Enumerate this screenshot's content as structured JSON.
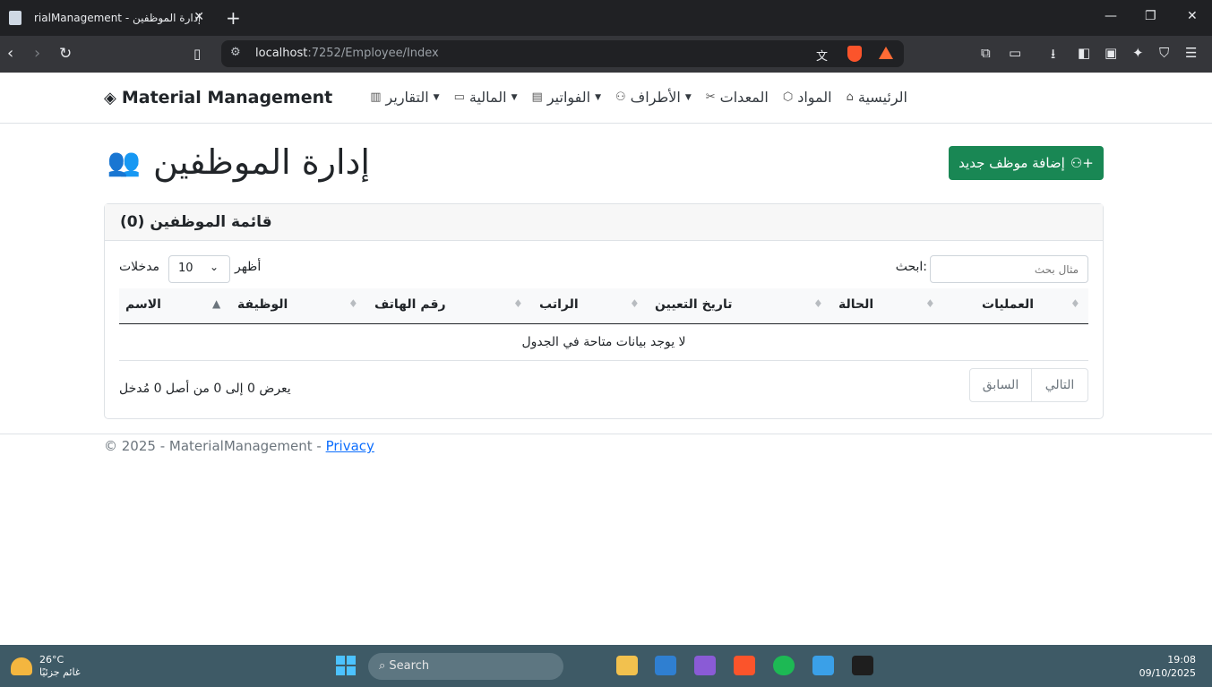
{
  "browser": {
    "tab_title": "rialManagement - إدارة الموظفين",
    "url_host": "localhost",
    "url_path": ":7252/Employee/Index",
    "colors": {
      "chrome_dark": "#202124",
      "toolbar": "#35363a"
    }
  },
  "navbar": {
    "brand": "Material Management",
    "links": [
      {
        "label": "الرئيسية",
        "icon": "home-icon"
      },
      {
        "label": "المواد",
        "icon": "box-icon"
      },
      {
        "label": "المعدات",
        "icon": "tools-icon"
      },
      {
        "label": "الأطراف",
        "icon": "people-icon",
        "dropdown": true
      },
      {
        "label": "الفواتير",
        "icon": "receipt-icon",
        "dropdown": true
      },
      {
        "label": "المالية",
        "icon": "folder-icon",
        "dropdown": true
      },
      {
        "label": "التقارير",
        "icon": "chart-icon",
        "dropdown": true
      }
    ]
  },
  "page": {
    "heading": "إدارة الموظفين",
    "add_button": "إضافة موظف جديد",
    "card_title": "قائمة الموظفين (0)",
    "search_label": ":ابحث",
    "search_placeholder": "مثال بحث",
    "length_show": "أظهر",
    "length_value": "10",
    "length_entries": "مدخلات",
    "columns": [
      "الاسم",
      "الوظيفة",
      "رقم الهاتف",
      "الراتب",
      "تاريخ التعيين",
      "الحالة",
      "العمليات"
    ],
    "empty_message": "لا يوجد بيانات متاحة في الجدول",
    "info": "يعرض 0 إلى 0 من أصل 0 مُدخل",
    "pager_prev": "السابق",
    "pager_next": "التالي",
    "colors": {
      "success": "#198754",
      "link": "#0d6efd"
    }
  },
  "footer": {
    "text": "© 2025 - MaterialManagement - ",
    "link": "Privacy"
  },
  "taskbar": {
    "temp": "26°C",
    "weather": "غائم جزئيًا",
    "search": "Search",
    "time": "19:08",
    "date": "09/10/2025"
  }
}
